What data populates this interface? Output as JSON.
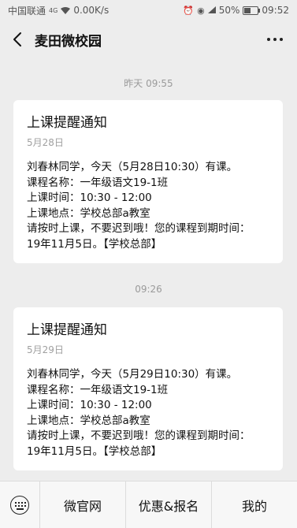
{
  "status_bar": {
    "carrier": "中国联通",
    "network": "4G",
    "speed": "0.00K/s",
    "battery": "50%",
    "time": "09:52",
    "battery_level": 0.5
  },
  "header": {
    "title": "麦田微校园"
  },
  "messages": [
    {
      "time": "昨天 09:55",
      "title": "上课提醒通知",
      "date": "5月28日",
      "lines": [
        "刘春林同学，今天（5月28日10:30）有课。",
        "课程名称：一年级语文19-1班",
        "上课时间：10:30 - 12:00",
        "上课地点：学校总部a教室",
        "请按时上课，不要迟到哦！您的课程到期时间：",
        "19年11月5日。【学校总部】"
      ]
    },
    {
      "time": "09:26",
      "title": "上课提醒通知",
      "date": "5月29日",
      "lines": [
        "刘春林同学，今天（5月29日10:30）有课。",
        "课程名称：一年级语文19-1班",
        "上课时间：10:30 - 12:00",
        "上课地点：学校总部a教室",
        "请按时上课，不要迟到哦！您的课程到期时间：",
        "19年11月5日。【学校总部】"
      ]
    }
  ],
  "bottom_menu": {
    "items": [
      "微官网",
      "优惠&报名",
      "我的"
    ]
  },
  "icons": {
    "back": "back-arrow-icon",
    "more": "more-dots-icon",
    "keyboard": "keyboard-icon"
  }
}
